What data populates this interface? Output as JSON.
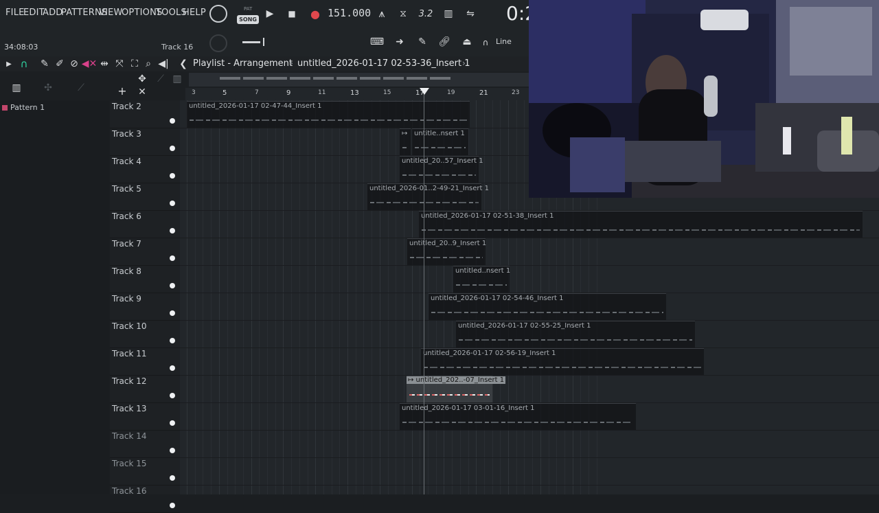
{
  "menu": [
    "FILE",
    "EDIT",
    "ADD",
    "PATTERNS",
    "VIEW",
    "OPTIONS",
    "TOOLS",
    "HELP"
  ],
  "transport": {
    "pat_label": "PAT",
    "song_label": "SONG",
    "tempo": "151.000",
    "clock": "0:2",
    "timecode": "34:08:03",
    "track_hint": "Track 16",
    "snap": "Line"
  },
  "playlist": {
    "title": "Playlist - Arrangement",
    "file": "untitled_2026-01-17 02-53-36_Insert 1"
  },
  "browser": {
    "pattern": "Pattern 1"
  },
  "ruler": [
    "3",
    "5",
    "7",
    "9",
    "11",
    "13",
    "15",
    "17",
    "19",
    "21",
    "23"
  ],
  "tracks": [
    {
      "name": "Track 2",
      "clips": [
        {
          "label": "untitled_2026-01-17 02-47-44_Insert 1",
          "selected": false
        }
      ]
    },
    {
      "name": "Track 3",
      "clips": [
        {
          "label": "↦",
          "selected": false
        },
        {
          "label": "untitle..nsert 1",
          "selected": false
        }
      ]
    },
    {
      "name": "Track 4",
      "clips": [
        {
          "label": "untitled_20..57_Insert 1",
          "selected": false
        }
      ]
    },
    {
      "name": "Track 5",
      "clips": [
        {
          "label": "untitled_2026-01..2-49-21_Insert 1",
          "selected": false
        }
      ]
    },
    {
      "name": "Track 6",
      "clips": [
        {
          "label": "untitled_2026-01-17 02-51-38_Insert 1",
          "selected": false
        }
      ]
    },
    {
      "name": "Track 7",
      "clips": [
        {
          "label": "untitled_20..9_Insert 1",
          "selected": false
        }
      ]
    },
    {
      "name": "Track 8",
      "clips": [
        {
          "label": "untitled..nsert 1",
          "selected": false
        }
      ]
    },
    {
      "name": "Track 9",
      "clips": [
        {
          "label": "untitled_2026-01-17 02-54-46_Insert 1",
          "selected": false
        }
      ]
    },
    {
      "name": "Track 10",
      "clips": [
        {
          "label": "untitled_2026-01-17 02-55-25_Insert 1",
          "selected": false
        }
      ]
    },
    {
      "name": "Track 11",
      "clips": [
        {
          "label": "untitled_2026-01-17 02-56-19_Insert 1",
          "selected": false
        }
      ]
    },
    {
      "name": "Track 12",
      "clips": [
        {
          "label": "↦ untitled_202..-07_Insert 1",
          "selected": true
        }
      ]
    },
    {
      "name": "Track 13",
      "clips": [
        {
          "label": "untitled_2026-01-17 03-01-16_Insert 1",
          "selected": false
        }
      ]
    },
    {
      "name": "Track 14",
      "clips": []
    },
    {
      "name": "Track 15",
      "clips": []
    },
    {
      "name": "Track 16",
      "clips": []
    }
  ]
}
